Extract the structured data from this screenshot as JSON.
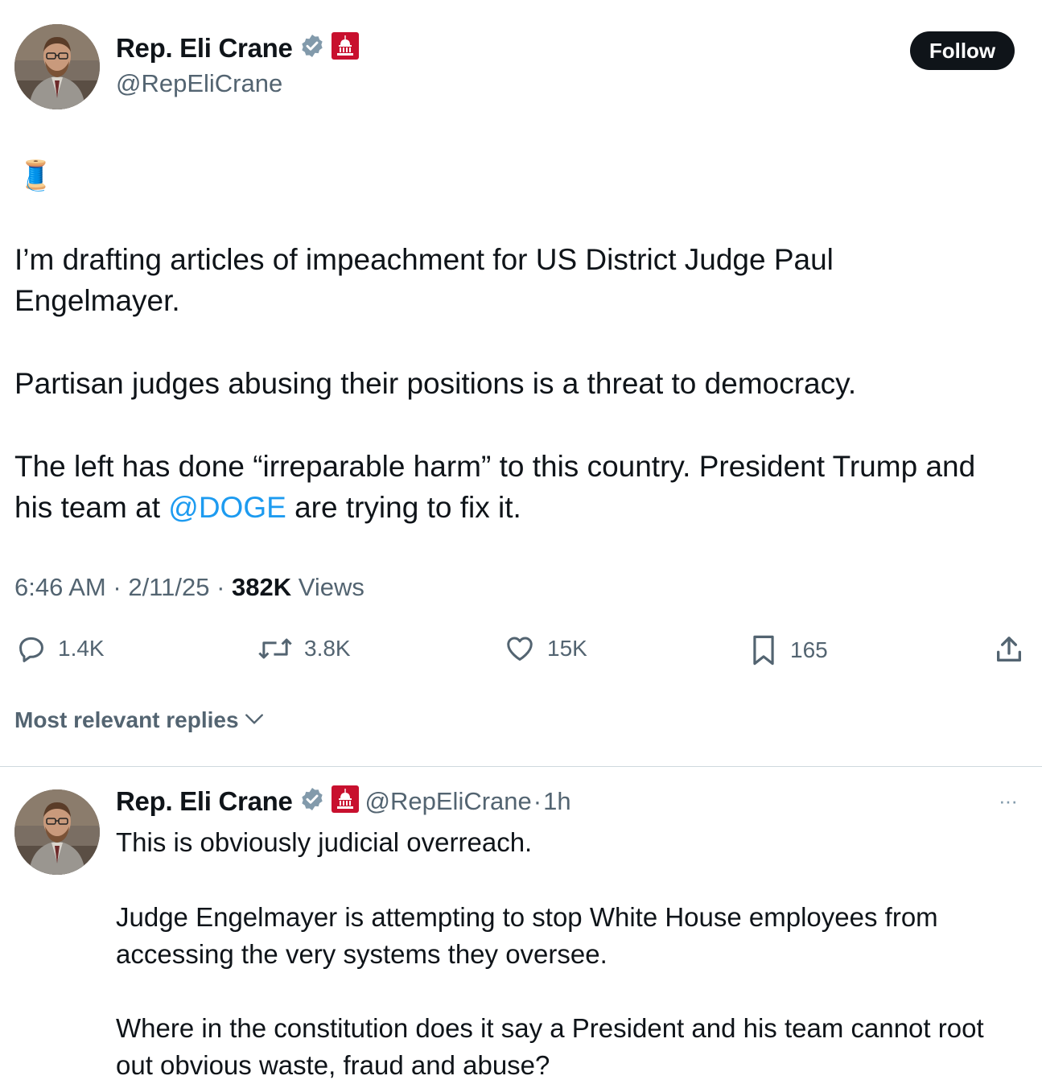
{
  "tweet": {
    "author_name": "Rep. Eli Crane",
    "author_handle": "@RepEliCrane",
    "follow_label": "Follow",
    "emoji": "🧵",
    "lines": [
      "I’m drafting articles of impeachment for US District Judge Paul",
      "Engelmayer.",
      "Partisan judges abusing their positions is a threat to democracy.",
      "The left has done “irreparable harm” to this country. President Trump and"
    ],
    "last_line_prefix": "his team at ",
    "mention": "@DOGE",
    "last_line_suffix": " are trying to fix it.",
    "time": "6:46 AM",
    "date": "2/11/25",
    "separator": "·",
    "views_count": "382K",
    "views_label": "Views"
  },
  "actions": {
    "replies": "1.4K",
    "reposts": "3.8K",
    "likes": "15K",
    "bookmarks": "165"
  },
  "replies_sort": {
    "label": "Most relevant replies"
  },
  "reply": {
    "author_name": "Rep. Eli Crane",
    "author_handle": "@RepEliCrane",
    "separator": "·",
    "time_ago": "1h",
    "more": "···",
    "lines": [
      "This is obviously judicial overreach.",
      "Judge Engelmayer is attempting to stop White House employees from",
      "accessing the very systems they oversee.",
      "Where in the constitution does it say a President and his team cannot root",
      "out obvious waste, fraud and abuse?"
    ]
  },
  "colors": {
    "text": "#0f1419",
    "secondary": "#536471",
    "link": "#1d9bf0",
    "verified_badge": "#829aab",
    "affiliate_badge": "#c8102e"
  }
}
